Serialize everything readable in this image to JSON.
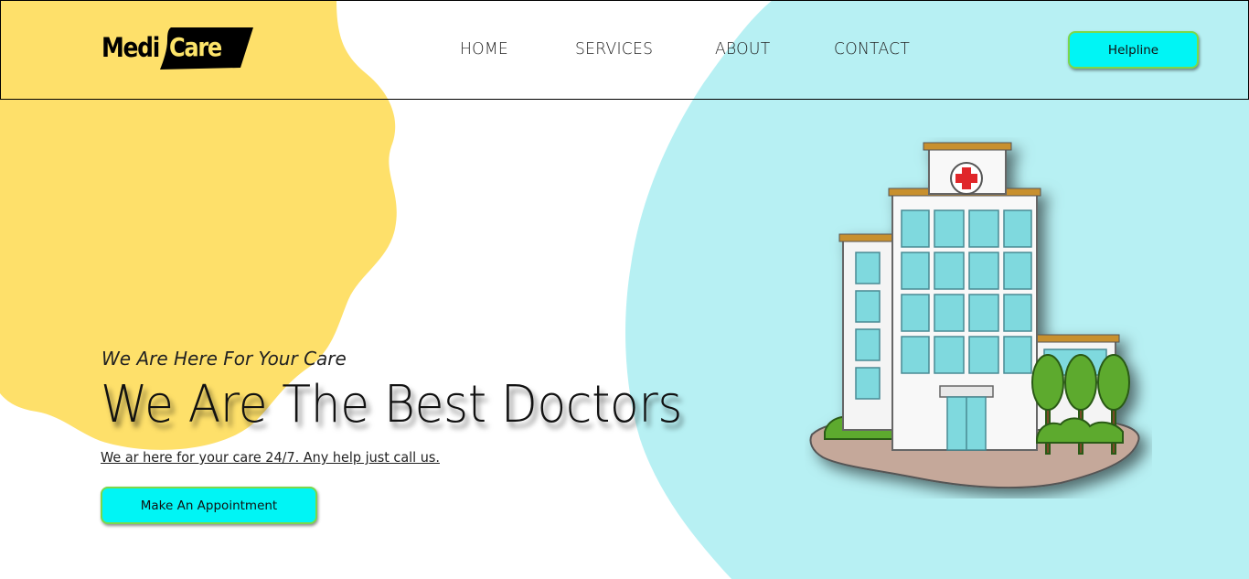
{
  "header": {
    "logo": {
      "part1": "Medi",
      "part2": "Care"
    },
    "nav": [
      {
        "label": "HOME"
      },
      {
        "label": "SERVICES"
      },
      {
        "label": "ABOUT"
      },
      {
        "label": "CONTACT"
      }
    ],
    "helpline_label": "Helpline"
  },
  "hero": {
    "tagline": "We Are Here For Your Care",
    "title": "We Are The Best Doctors",
    "subtitle": "We ar here for your care 24/7. Any help just call us.",
    "cta_label": "Make An Appointment",
    "illustration_icon": "hospital-building-icon"
  },
  "colors": {
    "yellow_blob": "#fee06a",
    "cyan_blob": "#b7f0f3",
    "button_bg": "#00f5f5",
    "button_border": "#7bd84a"
  }
}
